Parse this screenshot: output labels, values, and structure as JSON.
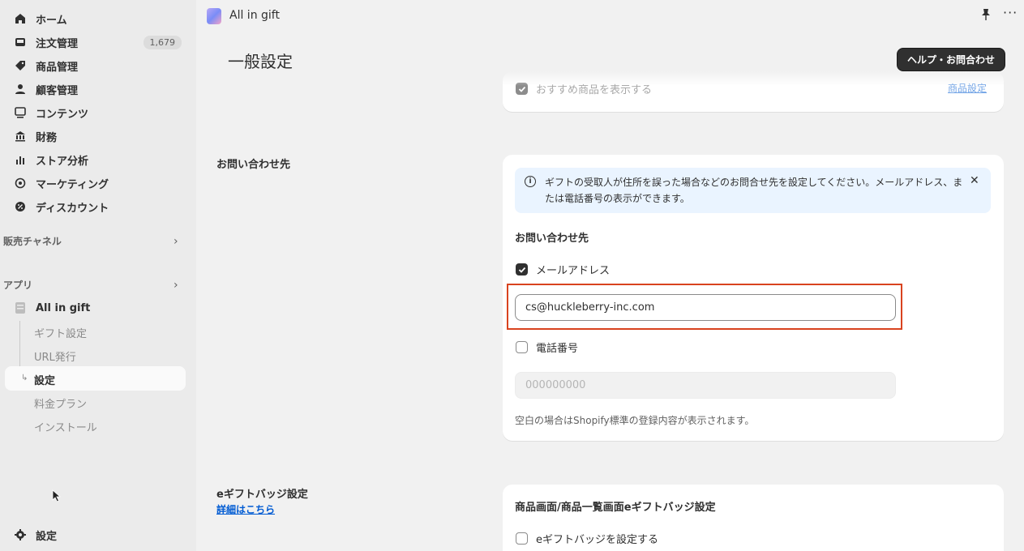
{
  "sidebar": {
    "items": [
      {
        "label": "ホーム",
        "icon": "home-icon"
      },
      {
        "label": "注文管理",
        "icon": "inbox-icon",
        "count": "1,679"
      },
      {
        "label": "商品管理",
        "icon": "tag-icon"
      },
      {
        "label": "顧客管理",
        "icon": "person-icon"
      },
      {
        "label": "コンテンツ",
        "icon": "content-icon"
      },
      {
        "label": "財務",
        "icon": "bank-icon"
      },
      {
        "label": "ストア分析",
        "icon": "bar-chart-icon"
      },
      {
        "label": "マーケティング",
        "icon": "target-icon"
      },
      {
        "label": "ディスカウント",
        "icon": "discount-icon"
      }
    ],
    "sales_channels_label": "販売チャネル",
    "apps_label": "アプリ",
    "app_name": "All in gift",
    "app_sub_items": [
      "ギフト設定",
      "URL発行",
      "設定",
      "料金プラン",
      "インストール"
    ],
    "settings_label": "設定"
  },
  "topbar": {
    "app_title": "All in gift"
  },
  "page": {
    "title": "一般設定",
    "help_button": "ヘルプ・お問合わせ",
    "top_card": {
      "checkbox_label": "おすすめ商品を表示する",
      "link": "商品設定"
    },
    "contact_section": {
      "title": "お問い合わせ先",
      "banner_text": "ギフトの受取人が住所を誤った場合などのお問合せ先を設定してください。メールアドレス、または電話番号の表示ができます。",
      "subheading": "お問い合わせ先",
      "email_checkbox_label": "メールアドレス",
      "email_checked": true,
      "email_value": "cs@huckleberry-inc.com",
      "phone_checkbox_label": "電話番号",
      "phone_checked": false,
      "phone_placeholder": "000000000",
      "help_text": "空白の場合はShopify標準の登録内容が表示されます。"
    },
    "badge_section": {
      "title": "eギフトバッジ設定",
      "link": "詳細はこちら",
      "card_title": "商品画面/商品一覧画面eギフトバッジ設定",
      "checkbox_label": "eギフトバッジを設定する"
    }
  },
  "colors": {
    "highlight": "#d9431f",
    "primary_button": "#303030",
    "banner_bg": "#eaf4ff",
    "link": "#005bd3"
  }
}
